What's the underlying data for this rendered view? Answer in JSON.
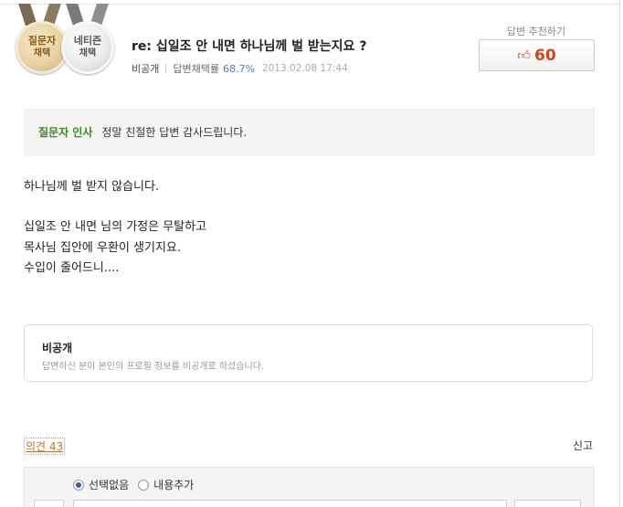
{
  "badges": {
    "gold": {
      "line1": "질문자",
      "line2": "채택"
    },
    "silver": {
      "line1": "네티즌",
      "line2": "채택"
    }
  },
  "answer": {
    "title": "re: 십일조 안 내면 하나님께 벌 받는지요 ?",
    "author": "비공개",
    "adopt_label": "답변채택률",
    "adopt_rate": "68.7%",
    "date": "2013.02.08 17:44"
  },
  "recommend": {
    "label": "답변 추천하기",
    "icon": "thumbs-up-icon",
    "count": "60"
  },
  "thanks": {
    "tag": "질문자 인사",
    "message": "정말 친절한 답변 감사드립니다."
  },
  "body": {
    "lines": [
      " 하나님께 벌 받지 않습니다.",
      "십일조  안 내면 님의 가정은 무탈하고",
      "목사님 집안에 우환이 생기지요.",
      "수입이 줄어드니...."
    ]
  },
  "profile": {
    "title": "비공개",
    "description": "답변하신 분이 본인의 프로필 정보를 비공개로 하셨습니다."
  },
  "opinion": {
    "label": "의견 43"
  },
  "report": {
    "label": "신고"
  },
  "comment": {
    "options": [
      "선택없음",
      "내용추가"
    ],
    "selected": "선택없음"
  },
  "colors": {
    "accent_red": "#d0451b",
    "accent_green": "#3e8b1e",
    "rate_blue": "#4f7bb8",
    "link_brown": "#b5793a"
  }
}
